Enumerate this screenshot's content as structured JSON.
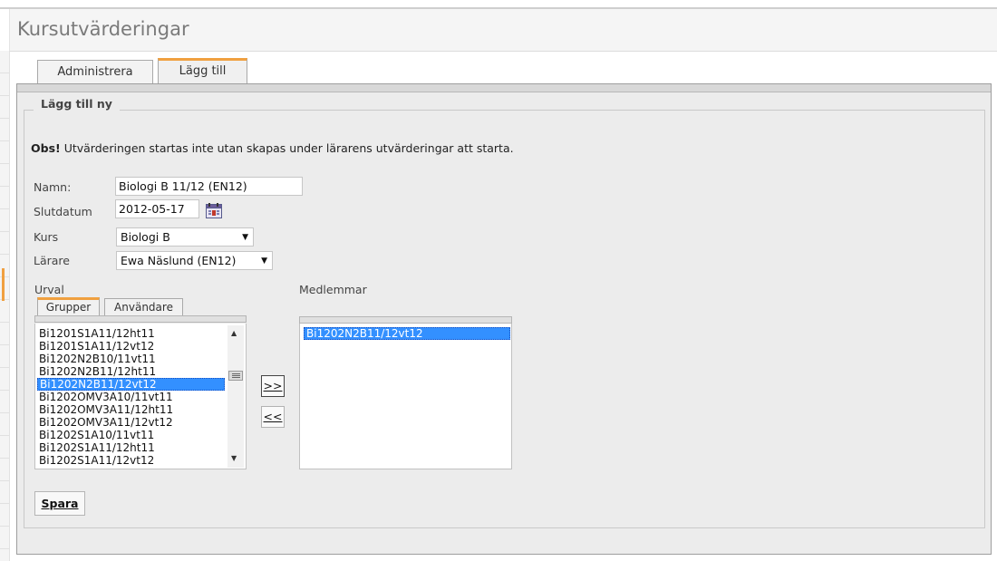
{
  "header": {
    "title": "Kursutvärderingar"
  },
  "tabs": [
    {
      "label": "Administrera"
    },
    {
      "label": "Lägg till"
    }
  ],
  "form": {
    "legend": "Lägg till ny",
    "notice_strong": "Obs!",
    "notice_text": " Utvärderingen startas inte utan skapas under lärarens utvärderingar att starta.",
    "name_label": "Namn:",
    "name_value": "Biologi B 11/12 (EN12)",
    "end_date_label": "Slutdatum",
    "end_date_value": "2012-05-17",
    "course_label": "Kurs",
    "course_value": "Biologi B",
    "teacher_label": "Lärare",
    "teacher_value": "Ewa Näslund (EN12)"
  },
  "selection": {
    "label": "Urval",
    "subtabs": [
      {
        "label": "Grupper"
      },
      {
        "label": "Användare"
      }
    ],
    "items": [
      "Bi1201S1A11/12ht11",
      "Bi1201S1A11/12vt12",
      "Bi1202N2B10/11vt11",
      "Bi1202N2B11/12ht11",
      "Bi1202N2B11/12vt12",
      "Bi1202OMV3A10/11vt11",
      "Bi1202OMV3A11/12ht11",
      "Bi1202OMV3A11/12vt12",
      "Bi1202S1A10/11vt11",
      "Bi1202S1A11/12ht11",
      "Bi1202S1A11/12vt12"
    ],
    "selected_index": 4
  },
  "move_buttons": {
    "add": ">>",
    "remove": "<<"
  },
  "members": {
    "label": "Medlemmar",
    "items": [
      "Bi1202N2B11/12vt12"
    ]
  },
  "save_label": "Spara",
  "colors": {
    "accent": "#f0a040",
    "selection": "#3390ff"
  }
}
